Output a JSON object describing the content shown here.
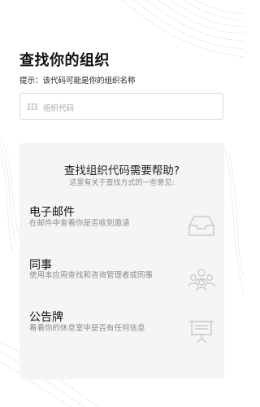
{
  "header": {
    "title": "查找你的组织",
    "hint": "提示：该代码可能是你的组织名称"
  },
  "org_code_input": {
    "placeholder": "组织代码",
    "icon": "grid-icon"
  },
  "help": {
    "title": "查找组织代码需要帮助?",
    "subtitle": "这里有关于查找方式的一些意见:",
    "items": [
      {
        "title": "电子邮件",
        "description": "在邮件中查看你是否收到邀请",
        "icon": "inbox-tray-icon"
      },
      {
        "title": "同事",
        "description": "使用本应用查找和咨询管理者或同事",
        "icon": "people-group-icon"
      },
      {
        "title": "公告牌",
        "description": "看看你的休息室中是否有任何信息",
        "icon": "notice-board-icon"
      }
    ]
  },
  "colors": {
    "background": "#ffffff",
    "card": "#f5f5f5",
    "icon": "#c4c4c4",
    "muted_text": "#8a8a8a"
  }
}
